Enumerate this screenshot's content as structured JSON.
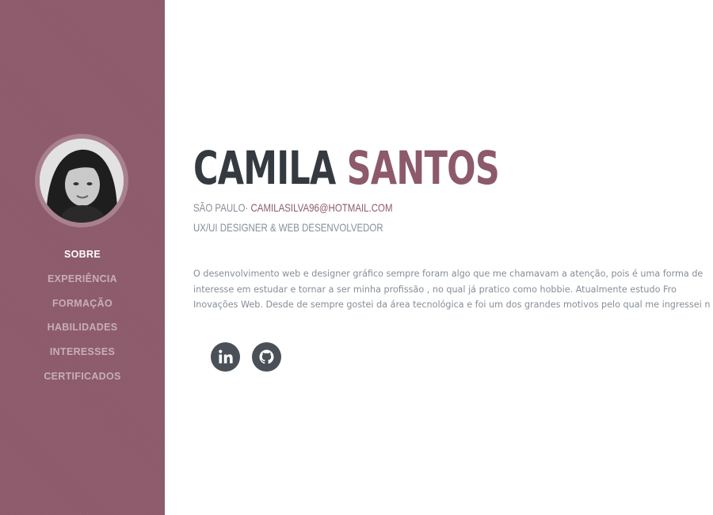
{
  "sidebar": {
    "avatar_icon": "profile-photo",
    "nav": [
      {
        "label": "SOBRE",
        "active": true
      },
      {
        "label": "EXPERIÊNCIA",
        "active": false
      },
      {
        "label": "FORMAÇÃO",
        "active": false
      },
      {
        "label": "HABILIDADES",
        "active": false
      },
      {
        "label": "INTERESSES",
        "active": false
      },
      {
        "label": "CERTIFICADOS",
        "active": false
      }
    ]
  },
  "header": {
    "first_name": "CAMILA",
    "last_name": "SANTOS",
    "location": "SÃO PAULO·",
    "email": "CAMILASILVA96@HOTMAIL.COM",
    "role": "UX/UI DESIGNER & WEB DESENVOLVEDOR"
  },
  "about": {
    "lines": [
      "O desenvolvimento web e designer gráfico sempre foram algo que me chamavam a atenção, pois é uma forma de",
      "interesse em estudar e tornar a ser minha profissão , no qual já pratico como hobbie. Atualmente estudo Fro",
      "Inovações Web. Desde de sempre gostei da área tecnológica e foi um dos grandes motivos pelo qual me ingressei n"
    ]
  },
  "social": {
    "linkedin_icon": "linkedin-icon",
    "github_icon": "github-icon"
  },
  "colors": {
    "accent": "#8c5a6a",
    "sidebar_bg": "#8c5a6a",
    "heading": "#343a40",
    "muted_text": "#868e96",
    "social_bg": "#495057"
  }
}
